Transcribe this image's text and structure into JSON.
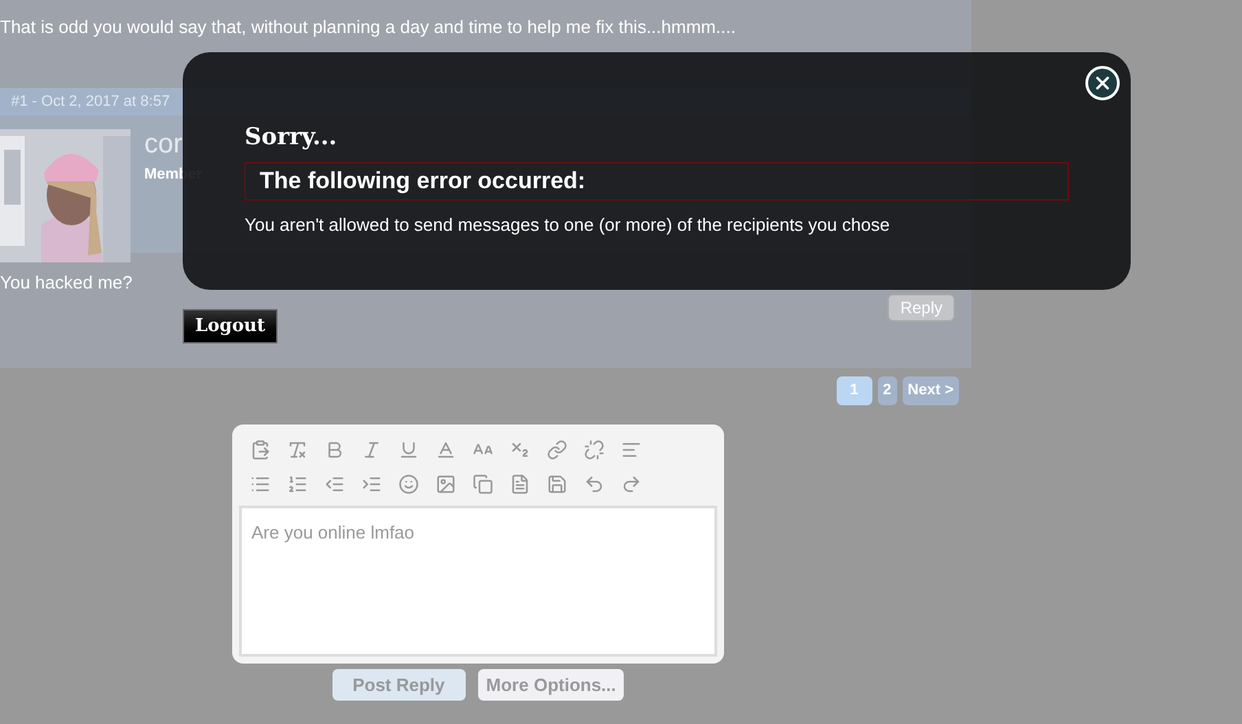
{
  "thread": {
    "previous_post_text": "That is odd you would say that, without planning a day and time to help me fix this...hmmm....",
    "post_header": "#1 - Oct 2, 2017 at 8:57",
    "author": {
      "name": "cor",
      "role": "Member"
    },
    "post_text": "You hacked me?",
    "reply_button": "Reply"
  },
  "logout_button": "Logout",
  "pagination": {
    "pages": [
      {
        "label": "1",
        "selected": true
      },
      {
        "label": "2",
        "selected": false
      }
    ],
    "next": "Next >"
  },
  "editor": {
    "placeholder": "Are you online lmfao",
    "buttons": [
      {
        "label": "Post Reply",
        "kind": "primary"
      },
      {
        "label": "More Options...",
        "kind": "secondary"
      }
    ]
  },
  "error_dialog": {
    "title": "Sorry...",
    "heading": "The following error occurred:",
    "message": "You aren't allowed to send messages to one (or more) of the recipients you chose"
  }
}
